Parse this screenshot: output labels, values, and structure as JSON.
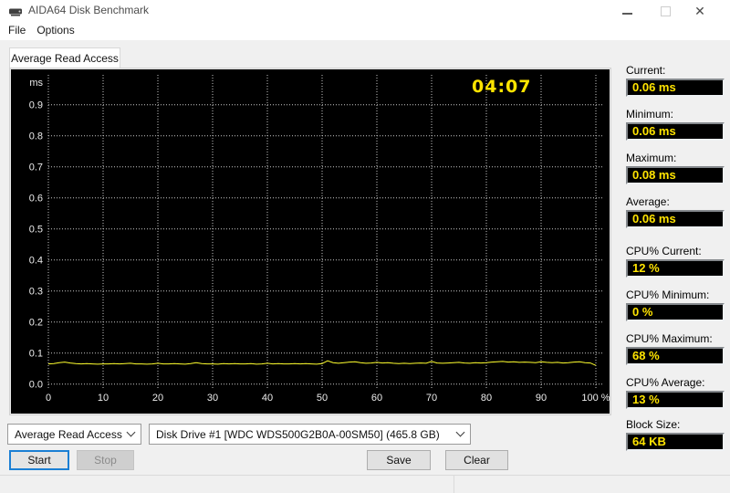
{
  "window": {
    "title": "AIDA64 Disk Benchmark"
  },
  "menu": {
    "items": [
      "File",
      "Options"
    ]
  },
  "tab": {
    "label": "Average Read Access"
  },
  "chart_data": {
    "type": "line",
    "title": "Average Read Access",
    "timer": "04:07",
    "xlabel": "",
    "ylabel": "ms",
    "xlim": [
      0,
      100
    ],
    "ylim": [
      0,
      1.0
    ],
    "grid": true,
    "grid_color": "#c8c8c8",
    "tick_color": "#ededed",
    "x_tick_labels": [
      "0",
      "10",
      "20",
      "30",
      "40",
      "50",
      "60",
      "70",
      "80",
      "90",
      "100 %"
    ],
    "y_tick_labels": [
      "0.0",
      "0.1",
      "0.2",
      "0.3",
      "0.4",
      "0.5",
      "0.6",
      "0.7",
      "0.8",
      "0.9"
    ],
    "series": [
      {
        "name": "read-access-time-ms",
        "color": "#ffff2e",
        "x_step_percent": 1,
        "values": [
          0.065,
          0.066,
          0.069,
          0.071,
          0.068,
          0.066,
          0.065,
          0.066,
          0.065,
          0.064,
          0.065,
          0.065,
          0.066,
          0.065,
          0.066,
          0.067,
          0.065,
          0.065,
          0.064,
          0.065,
          0.067,
          0.065,
          0.065,
          0.066,
          0.065,
          0.064,
          0.066,
          0.069,
          0.066,
          0.065,
          0.065,
          0.064,
          0.066,
          0.065,
          0.066,
          0.065,
          0.065,
          0.066,
          0.064,
          0.065,
          0.067,
          0.065,
          0.066,
          0.065,
          0.065,
          0.066,
          0.065,
          0.066,
          0.065,
          0.064,
          0.066,
          0.075,
          0.069,
          0.067,
          0.069,
          0.071,
          0.072,
          0.069,
          0.067,
          0.068,
          0.07,
          0.068,
          0.069,
          0.067,
          0.066,
          0.067,
          0.066,
          0.067,
          0.068,
          0.067,
          0.073,
          0.068,
          0.067,
          0.068,
          0.069,
          0.07,
          0.068,
          0.067,
          0.069,
          0.068,
          0.069,
          0.071,
          0.072,
          0.073,
          0.071,
          0.072,
          0.07,
          0.071,
          0.07,
          0.069,
          0.072,
          0.07,
          0.069,
          0.07,
          0.068,
          0.069,
          0.071,
          0.072,
          0.069,
          0.068,
          0.06
        ]
      }
    ]
  },
  "stats": [
    {
      "label": "Current:",
      "value": "0.06 ms"
    },
    {
      "label": "Minimum:",
      "value": "0.06 ms"
    },
    {
      "label": "Maximum:",
      "value": "0.08 ms"
    },
    {
      "label": "Average:",
      "value": "0.06 ms"
    },
    {
      "label": "CPU% Current:",
      "value": "12 %"
    },
    {
      "label": "CPU% Minimum:",
      "value": "0 %"
    },
    {
      "label": "CPU% Maximum:",
      "value": "68 %"
    },
    {
      "label": "CPU% Average:",
      "value": "13 %"
    },
    {
      "label": "Block Size:",
      "value": "64 KB"
    }
  ],
  "controls": {
    "benchmark_select": {
      "value": "Average Read Access"
    },
    "drive_select": {
      "value": "Disk Drive #1  [WDC WDS500G2B0A-00SM50]  (465.8 GB)"
    },
    "start_label": "Start",
    "stop_label": "Stop",
    "save_label": "Save",
    "clear_label": "Clear"
  },
  "colors": {
    "value_text_yellow": "#ffe400",
    "chart_line_yellow": "#ffff2e",
    "chart_background": "#000000",
    "focus_blue": "#1b7fd4",
    "window_background": "#f0f0f0"
  }
}
